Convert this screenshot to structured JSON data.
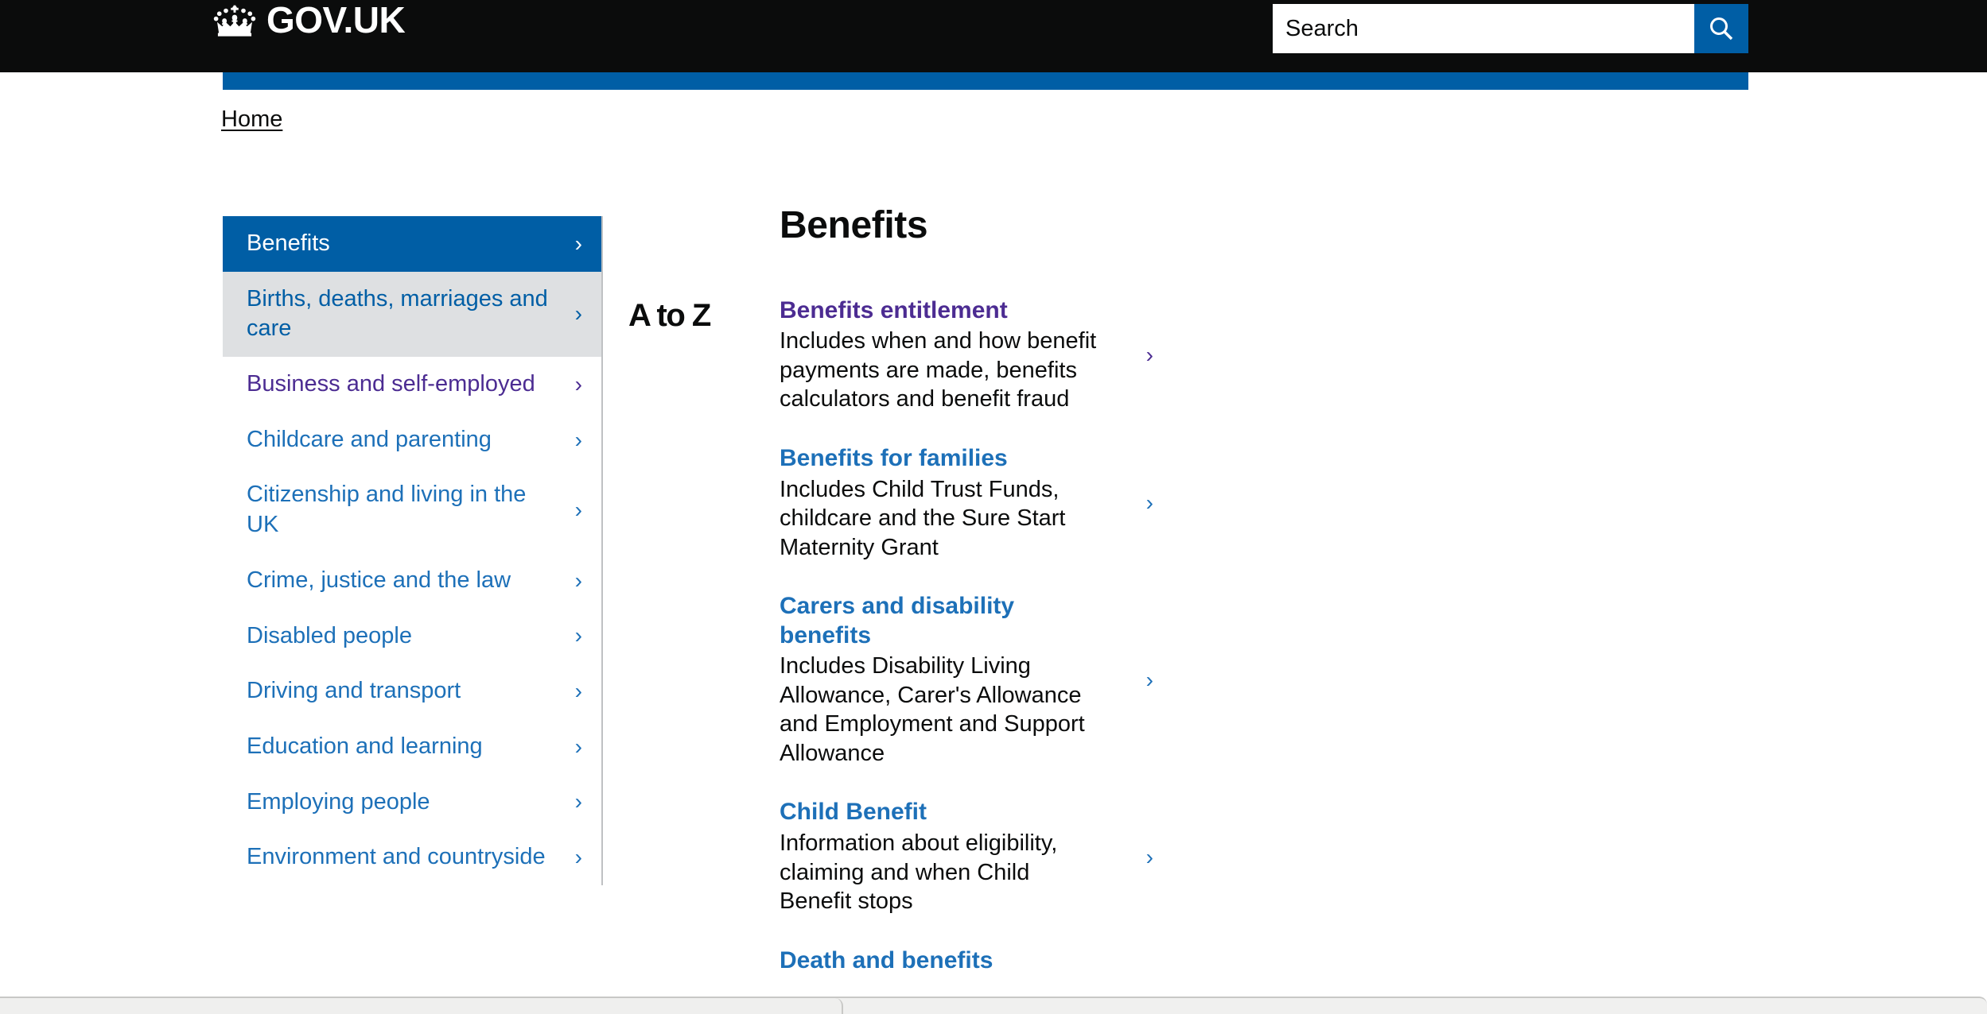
{
  "header": {
    "logo_text": "GOV.UK",
    "crown_icon": "crown-icon",
    "search": {
      "placeholder": "Search",
      "value": "",
      "button_icon": "search-icon"
    }
  },
  "breadcrumb": {
    "items": [
      {
        "label": "Home"
      }
    ]
  },
  "sidebar": {
    "items": [
      {
        "label": "Benefits",
        "state": "active",
        "chevron": "›"
      },
      {
        "label": "Births, deaths, marriages and care",
        "state": "hover",
        "chevron": "›"
      },
      {
        "label": "Business and self-employed",
        "state": "visited",
        "chevron": "›"
      },
      {
        "label": "Childcare and parenting",
        "state": "default",
        "chevron": "›"
      },
      {
        "label": "Citizenship and living in the UK",
        "state": "default",
        "chevron": "›"
      },
      {
        "label": "Crime, justice and the law",
        "state": "default",
        "chevron": "›"
      },
      {
        "label": "Disabled people",
        "state": "default",
        "chevron": "›"
      },
      {
        "label": "Driving and transport",
        "state": "default",
        "chevron": "›"
      },
      {
        "label": "Education and learning",
        "state": "default",
        "chevron": "›"
      },
      {
        "label": "Employing people",
        "state": "default",
        "chevron": "›"
      },
      {
        "label": "Environment and countryside",
        "state": "default",
        "chevron": "›"
      }
    ]
  },
  "main": {
    "title": "Benefits",
    "atoz_label": "A to Z",
    "topics": [
      {
        "title": "Benefits entitlement",
        "description": "Includes when and how benefit payments are made, benefits calculators and benefit fraud",
        "state": "visited",
        "chevron": "›"
      },
      {
        "title": "Benefits for families",
        "description": "Includes Child Trust Funds, childcare and the Sure Start Maternity Grant",
        "state": "default",
        "chevron": "›"
      },
      {
        "title": "Carers and disability benefits",
        "description": "Includes Disability Living Allowance, Carer's Allowance and Employment and Support Allowance",
        "state": "default",
        "chevron": "›"
      },
      {
        "title": "Child Benefit",
        "description": "Information about eligibility, claiming and when Child Benefit stops",
        "state": "default",
        "chevron": "›"
      },
      {
        "title": "Death and benefits",
        "description": "",
        "state": "default",
        "chevron": "›"
      }
    ]
  },
  "colors": {
    "header_black": "#0b0c0c",
    "govuk_blue": "#005ea5",
    "link_blue": "#1d70b8",
    "link_visited": "#4c2c92",
    "hover_grey": "#dee0e2",
    "border_grey": "#bfc1c3"
  }
}
